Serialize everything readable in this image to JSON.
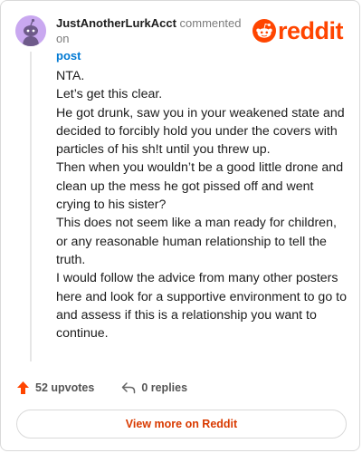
{
  "header": {
    "username": "JustAnotherLurkAcct",
    "commented_on": " commented on",
    "post_link": "post"
  },
  "brand": {
    "wordmark": "reddit",
    "color": "#ff4500"
  },
  "comment": {
    "paragraphs": [
      "NTA.",
      "Let’s get this clear.",
      "He got drunk, saw you in your weakened state and decided to forcibly hold you under the covers with particles of his sh!t until you threw up.",
      "Then when you wouldn’t be a good little drone and clean up the mess he got pissed off and went crying to his sister?",
      "This does not seem like a man ready for children, or any reasonable human relationship to tell the truth.",
      "I would follow the advice from many other posters here and look for a supportive environment to go to and assess if this is a relationship you want to continue."
    ]
  },
  "actions": {
    "upvotes": "52 upvotes",
    "replies": "0 replies"
  },
  "footer": {
    "view_more": "View more on Reddit"
  },
  "icons": {
    "avatar": "snoo-avatar-icon",
    "brand": "reddit-snoo-icon",
    "upvote": "upvote-arrow-icon",
    "reply": "reply-arrow-icon"
  },
  "colors": {
    "link": "#0079d3",
    "upvote": "#ff4500",
    "view_more_text": "#d93a00",
    "avatar_bg": "#c9a8f0"
  }
}
